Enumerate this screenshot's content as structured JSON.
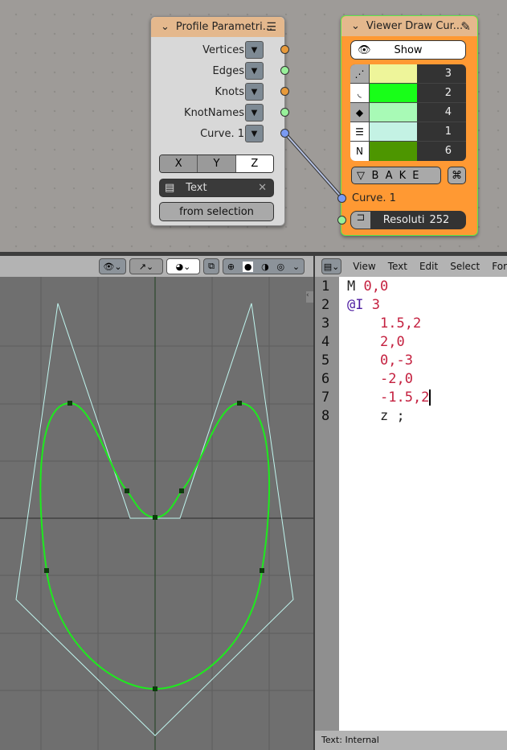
{
  "profile_node": {
    "title": "Profile Parametri...",
    "outputs": [
      "Vertices",
      "Edges",
      "Knots",
      "KnotNames",
      "Curve. 1"
    ],
    "axes": [
      "X",
      "Y",
      "Z"
    ],
    "active_axis": "Z",
    "text_field": "Text",
    "from_selection": "from selection"
  },
  "viewer_node": {
    "title": "Viewer Draw Cur...",
    "show_label": "Show",
    "rows": [
      {
        "icon": "vertex-icon",
        "color": "#eef59a",
        "value": "3"
      },
      {
        "icon": "curve-icon",
        "color": "#18ff18",
        "value": "2"
      },
      {
        "icon": "diamond-icon",
        "color": "#a8fab6",
        "value": "4"
      },
      {
        "icon": "edges-icon",
        "color": "#c4f2e4",
        "value": "1"
      },
      {
        "icon": "n-icon",
        "color": "#4d9600",
        "value": "6",
        "letter": "N"
      }
    ],
    "bake_label": "B A K E",
    "input_label": "Curve. 1",
    "resolution_label": "Resoluti",
    "resolution_value": "252"
  },
  "text_editor": {
    "menu": [
      "View",
      "Text",
      "Edit",
      "Select",
      "For"
    ],
    "lines": [
      {
        "n": "1"
      },
      {
        "n": "2"
      },
      {
        "n": "3"
      },
      {
        "n": "4"
      },
      {
        "n": "5"
      },
      {
        "n": "6"
      },
      {
        "n": "7"
      },
      {
        "n": "8"
      }
    ],
    "code": [
      "M ",
      "0,0",
      "@I",
      " 3",
      "1.5,2",
      "2,0",
      "0,-3",
      "-2,0",
      "-1.5,2",
      "z ;"
    ],
    "footer": "Text: Internal"
  },
  "colors": {
    "curve": "#1eea1e",
    "control_polygon": "#bff5ee",
    "node_header": "#e4b88d",
    "viewer_body": "#ff9933"
  }
}
